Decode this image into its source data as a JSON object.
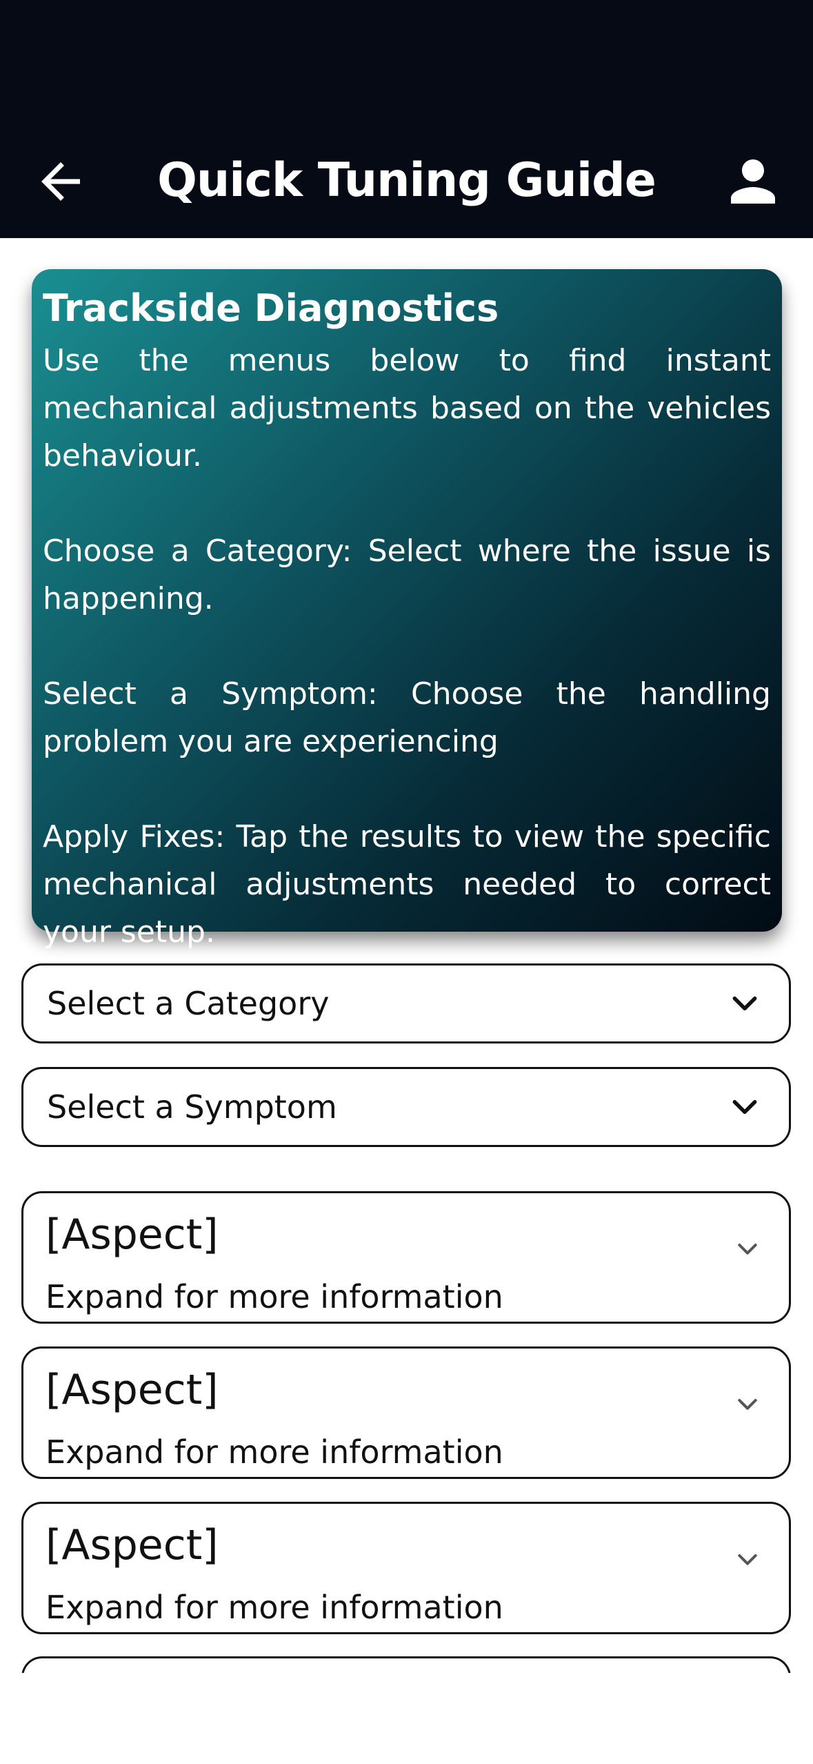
{
  "app_bar": {
    "title": "Quick Tuning Guide",
    "back_icon": "arrow-back-icon",
    "profile_icon": "person-icon"
  },
  "info_card": {
    "title": "Trackside Diagnostics",
    "paragraphs": [
      "Use the menus below to find instant mechanical adjustments based on the vehicles behaviour.",
      "Choose a Category: Select where the issue is happening.",
      "Select a Symptom: Choose the handling problem you are experiencing",
      "Apply Fixes: Tap the results to view the specific mechanical adjustments needed to correct your setup."
    ]
  },
  "filters": {
    "category_label": "Select a Category",
    "symptom_label": "Select a Symptom"
  },
  "aspects": [
    {
      "title": "[Aspect]",
      "subtitle": "Expand for more information"
    },
    {
      "title": "[Aspect]",
      "subtitle": "Expand for more information"
    },
    {
      "title": "[Aspect]",
      "subtitle": "Expand for more information"
    }
  ],
  "colors": {
    "app_bar_bg": "#050a14",
    "card_gradient_start": "#1a8f92",
    "card_gradient_end": "#020b14"
  }
}
